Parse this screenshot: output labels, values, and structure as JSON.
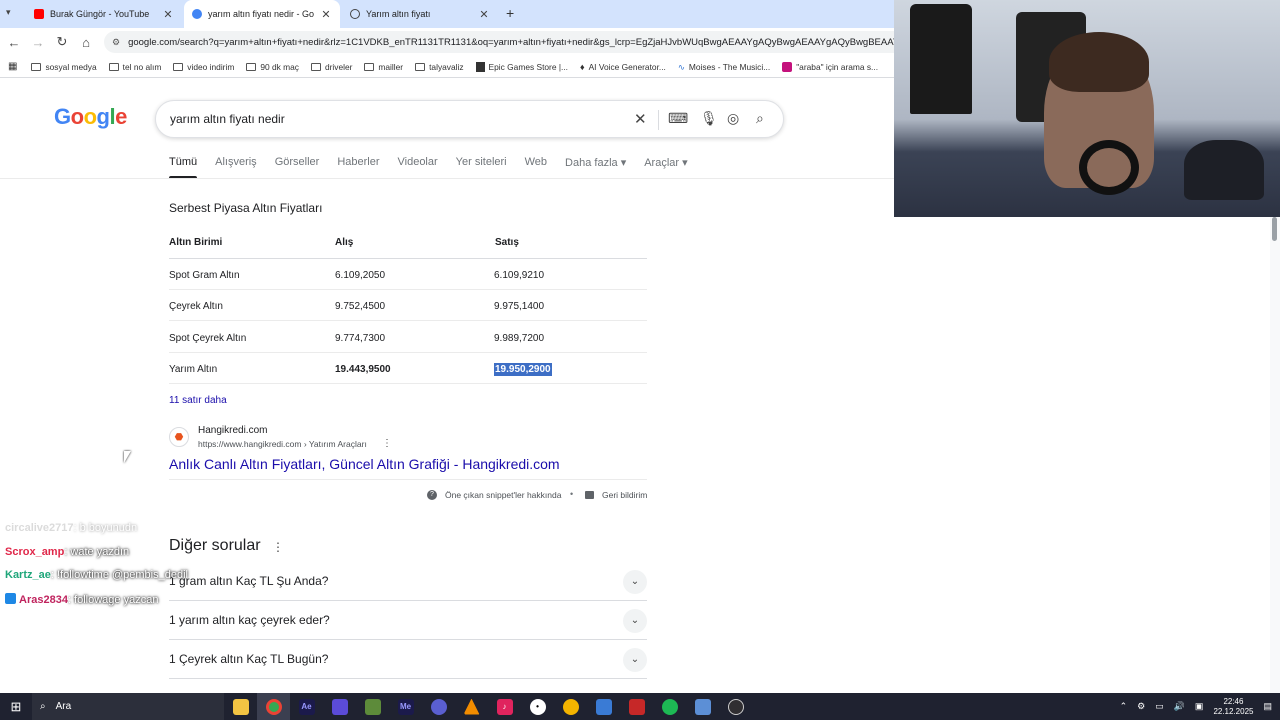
{
  "browser": {
    "tabs": [
      {
        "title": "Burak Güngör - YouTube",
        "color": "#ff0000"
      },
      {
        "title": "yarım altın fiyatı nedir - Google",
        "color": "#4285f4"
      },
      {
        "title": "Yarım altın fiyatı",
        "color": "#444444"
      }
    ],
    "new_tab": "+",
    "url": "google.com/search?q=yarım+altın+fiyatı+nedir&rlz=1C1VDKB_enTR1131TR1131&oq=yarım+altın+fiyatı+nedir&gs_lcrp=EgZjaHJvbWUqBwgAEAAYgAQyBwgAEAAYgAQyBwgBEAAYgAQy",
    "bookmarks": [
      "sosyal medya",
      "tel no alım",
      "video indirim",
      "90 dk maç",
      "driveler",
      "mailler",
      "talyavaliz",
      "Epic Games Store |...",
      "AI Voice Generator...",
      "Moises - The Musici...",
      "\"araba\" için arama s..."
    ]
  },
  "google": {
    "logo": "Google",
    "query": "yarım altın fiyatı nedir",
    "nav": [
      "Tümü",
      "Alışveriş",
      "Görseller",
      "Haberler",
      "Videolar",
      "Yer siteleri",
      "Web",
      "Daha fazla",
      "Araçlar"
    ]
  },
  "snippet": {
    "title": "Serbest Piyasa Altın Fiyatları",
    "headers": [
      "Altın Birimi",
      "Alış",
      "Satış"
    ],
    "rows": [
      {
        "name": "Spot Gram Altın",
        "buy": "6.109,2050",
        "sell": "6.109,9210"
      },
      {
        "name": "Çeyrek Altın",
        "buy": "9.752,4500",
        "sell": "9.975,1400"
      },
      {
        "name": "Spot Çeyrek Altın",
        "buy": "9.774,7300",
        "sell": "9.989,7200"
      },
      {
        "name": "Yarım Altın",
        "buy": "19.443,9500",
        "sell": "19.950,2900"
      }
    ],
    "more": "11 satır daha",
    "source_name": "Hangikredi.com",
    "source_url": "https://www.hangikredi.com › Yatırım Araçları",
    "link": "Anlık Canlı Altın Fiyatları, Güncel Altın Grafiği - Hangikredi.com",
    "about": "Öne çıkan snippet'ler hakkında",
    "feedback": "Geri bildirim"
  },
  "paa": {
    "title": "Diğer sorular",
    "questions": [
      "1 gram altın Kaç TL Şu Anda?",
      "1 yarım altın kaç çeyrek eder?",
      "1 Çeyrek altın Kaç TL Bugün?"
    ]
  },
  "chat": [
    {
      "user": "circalive2717",
      "msg": ": b boyunudn",
      "color": "#e0e0e0"
    },
    {
      "user": "Scrox_amp",
      "msg": ": wate yazdın",
      "color": "#e0284a"
    },
    {
      "user": "Kartz_ae",
      "msg": ": !followtime @pembis_dedil",
      "color": "#1fa67a"
    },
    {
      "user": "Aras2834",
      "msg": ": followage yazcan",
      "color": "#c0245e"
    }
  ],
  "taskbar": {
    "search": "Ara",
    "time": "22:46",
    "date": "22.12.2025"
  }
}
